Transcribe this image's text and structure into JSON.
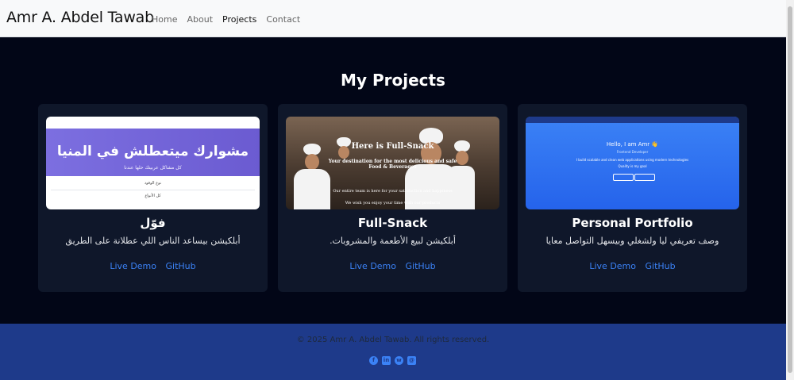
{
  "navbar": {
    "brand": "Amr A. Abdel Tawab",
    "links": [
      "Home",
      "About",
      "Projects",
      "Contact"
    ]
  },
  "section": {
    "title": "My Projects"
  },
  "projects": [
    {
      "title": "فوّل",
      "description": "أبلكيشن بيساعد الناس اللي عطلانة على الطريق",
      "live_label": "Live Demo",
      "github_label": "GitHub",
      "thumb": {
        "heading": "مشوارك ميتعطلش في المنيا",
        "sub": "كل مشاكل عربيتك حلها عندنا",
        "line1": "نوع الوقود",
        "line2": "كل الأنواع"
      }
    },
    {
      "title": "Full-Snack",
      "description": "أبلكيشن لبيع الأطعمة والمشروبات.",
      "live_label": "Live Demo",
      "github_label": "GitHub",
      "thumb": {
        "heading": "Here is Full-Snack",
        "sub": "Your destination for the most delicious and safe Food & Beverages",
        "line1": "Our entire team is here for your satisfaction and happiness",
        "line2": "We wish you enjoy your time with our products"
      }
    },
    {
      "title": "Personal Portfolio",
      "description": "وصف تعريفي ليا ولشغلي وبيسهل التواصل معايا",
      "live_label": "Live Demo",
      "github_label": "GitHub",
      "thumb": {
        "heading": "Hello, I am Amr 👋",
        "sub": "Frontend Developer",
        "line1": "I build scalable and clean web applications using modern technologies",
        "line2": "Quality is my goal",
        "btn1": "View my Work",
        "btn2": "Contact Me"
      }
    }
  ],
  "footer": {
    "copyright": "© 2025 Amr A. Abdel Tawab. All rights reserved.",
    "socials": [
      "facebook-icon",
      "linkedin-icon",
      "whatsapp-icon",
      "email-icon"
    ]
  },
  "colors": {
    "background": "#020617",
    "card": "#0f172a",
    "link": "#3b82f6",
    "footer": "#1e3a8a"
  }
}
